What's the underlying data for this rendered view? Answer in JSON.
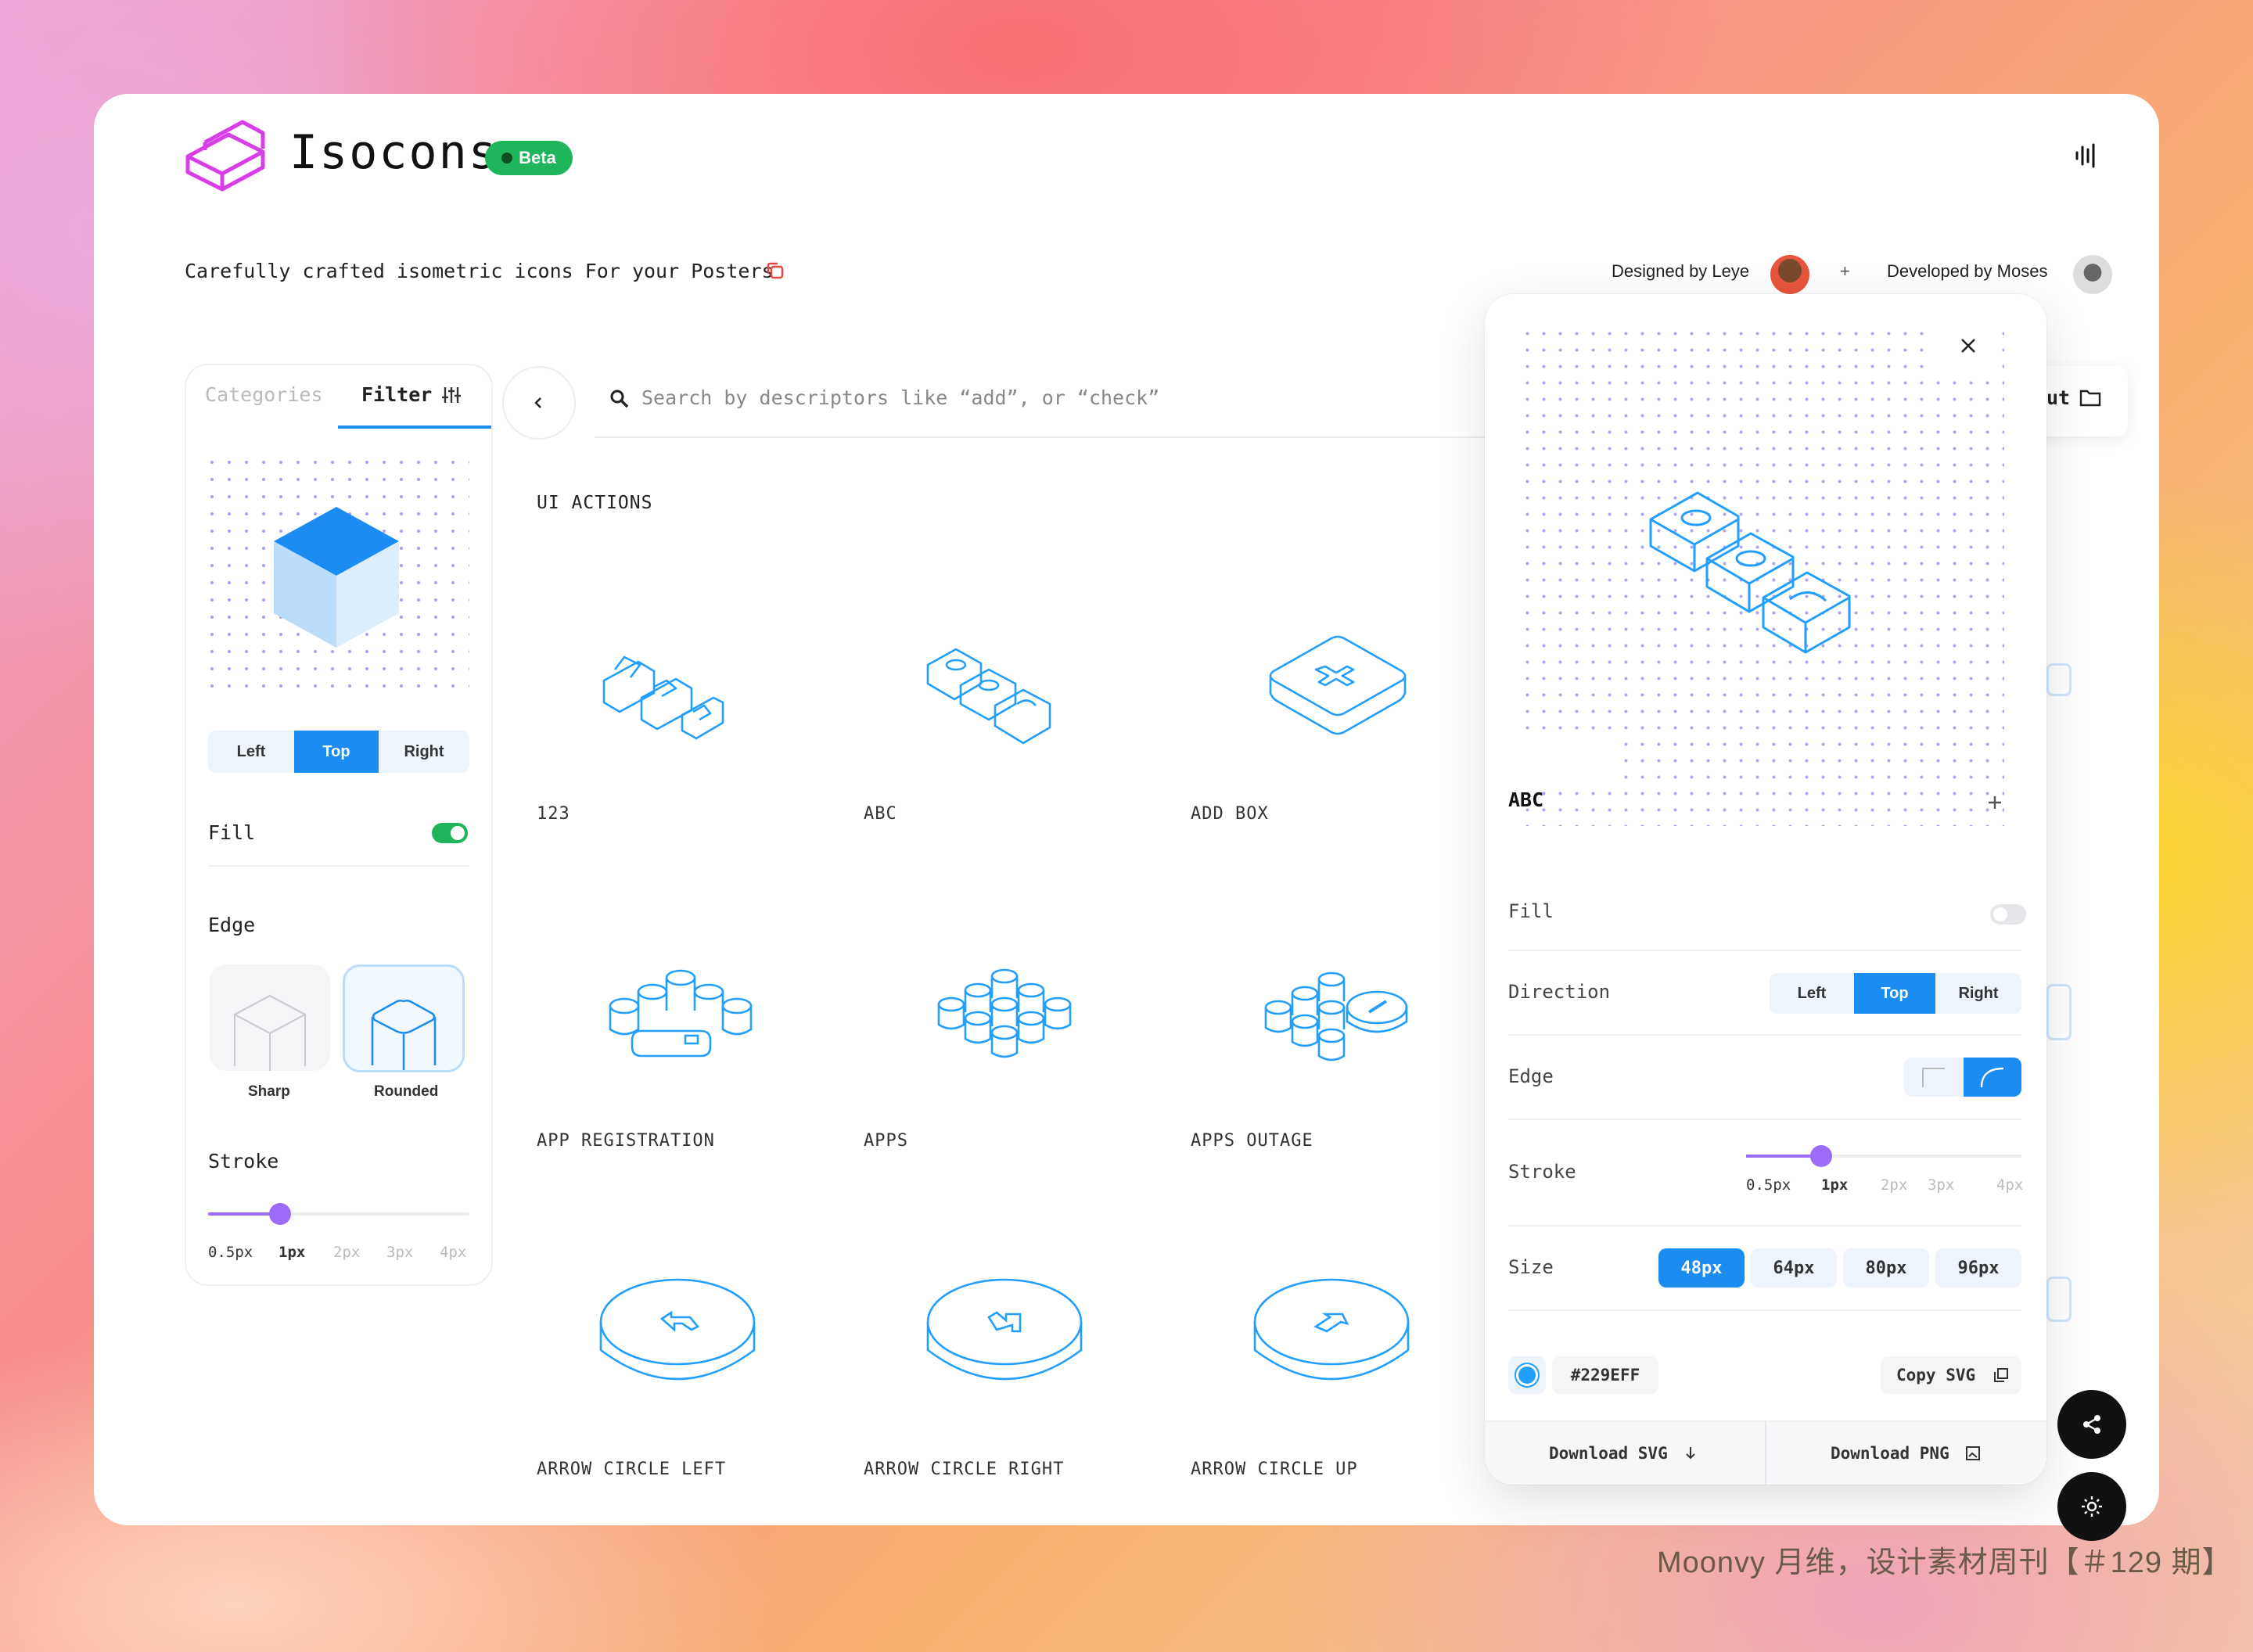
{
  "app": {
    "title": "Isocons",
    "badge": "Beta",
    "tagline": "Carefully crafted isometric icons For your Posters"
  },
  "credits": {
    "designed": "Designed by Leye",
    "plus": "+",
    "developed": "Developed by Moses"
  },
  "sidebar": {
    "tabs": [
      {
        "label": "Categories"
      },
      {
        "label": "Filter"
      }
    ],
    "direction": {
      "options": [
        "Left",
        "Top",
        "Right"
      ],
      "selected": "Top"
    },
    "fill": {
      "label": "Fill",
      "on": true
    },
    "edge": {
      "label": "Edge",
      "options": [
        "Sharp",
        "Rounded"
      ],
      "selected": "Rounded"
    },
    "stroke": {
      "label": "Stroke",
      "ticks": [
        "0.5px",
        "1px",
        "2px",
        "3px",
        "4px"
      ],
      "selected": "1px"
    }
  },
  "search": {
    "placeholder": "Search by descriptors like “add”, or “check”",
    "partial_button": "ut"
  },
  "section": {
    "title": "UI ACTIONS"
  },
  "icons": [
    {
      "name": "123"
    },
    {
      "name": "ABC"
    },
    {
      "name": "ADD BOX"
    },
    {
      "name": "APP REGISTRATION"
    },
    {
      "name": "APPS"
    },
    {
      "name": "APPS OUTAGE"
    },
    {
      "name": "ARROW CIRCLE LEFT"
    },
    {
      "name": "ARROW CIRCLE RIGHT"
    },
    {
      "name": "ARROW CIRCLE UP"
    }
  ],
  "detail": {
    "icon_name": "ABC",
    "fill": {
      "label": "Fill",
      "on": false
    },
    "direction": {
      "label": "Direction",
      "options": [
        "Left",
        "Top",
        "Right"
      ],
      "selected": "Top"
    },
    "edge": {
      "label": "Edge"
    },
    "stroke": {
      "label": "Stroke",
      "ticks": [
        "0.5px",
        "1px",
        "2px",
        "3px",
        "4px"
      ],
      "selected": "1px"
    },
    "size": {
      "label": "Size",
      "options": [
        "48px",
        "64px",
        "80px",
        "96px"
      ],
      "selected": "48px"
    },
    "color": {
      "hex": "#229EFF"
    },
    "copy_label": "Copy SVG",
    "download_svg": "Download SVG",
    "download_png": "Download PNG"
  },
  "colors": {
    "accent": "#1a8cf2",
    "fill_toggle": "#1fb55a",
    "stroke_slider": "#9b6cf5",
    "icon_stroke": "#229EFF"
  },
  "watermark": "Moonvy 月维，设计素材周刊【＃129 期】"
}
